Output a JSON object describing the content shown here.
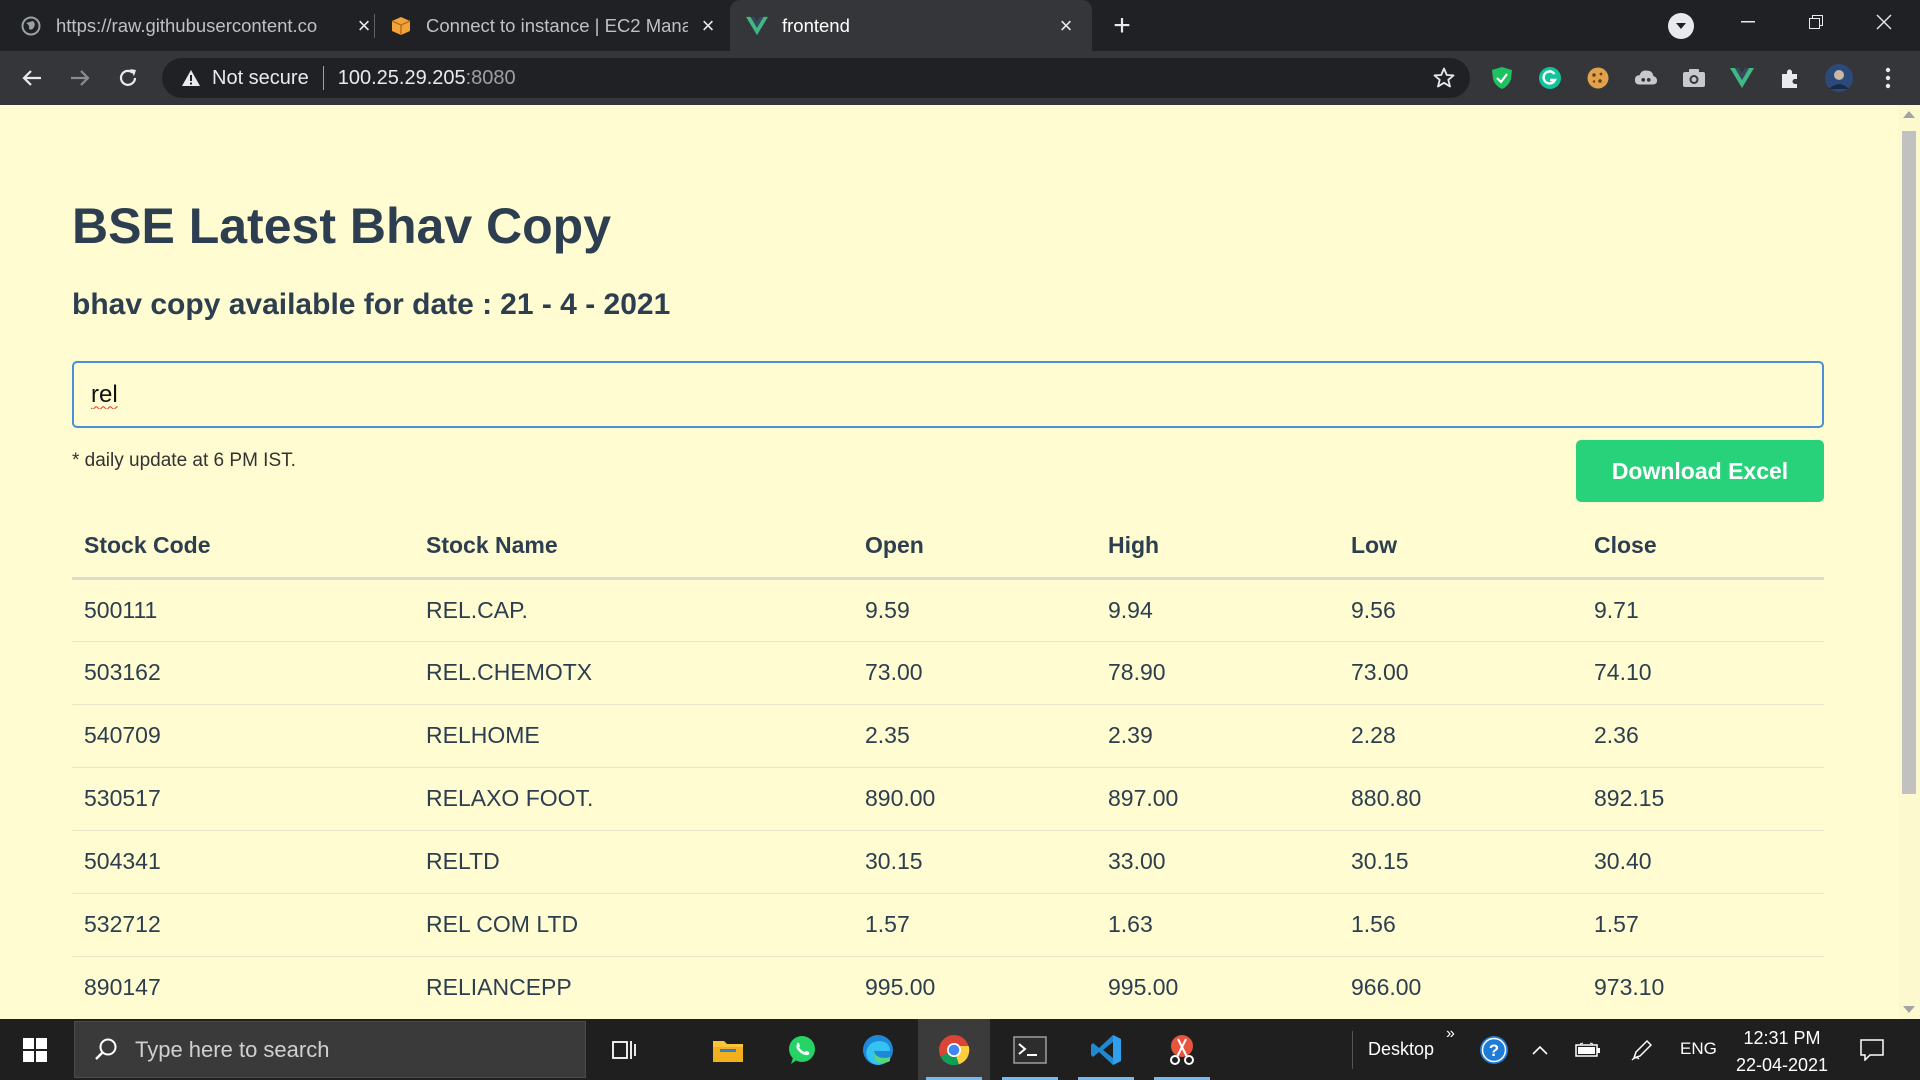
{
  "browser": {
    "tabs": [
      {
        "title": "https://raw.githubusercontent.co",
        "state": "inactive",
        "icon": "globe-icon"
      },
      {
        "title": "Connect to instance | EC2 Manag",
        "state": "inactive",
        "icon": "aws-box-icon"
      },
      {
        "title": "frontend",
        "state": "active",
        "icon": "vue-logo-icon"
      }
    ],
    "address": {
      "security_label": "Not secure",
      "host": "100.25.29.205",
      "port": ":8080"
    }
  },
  "page": {
    "title": "BSE Latest Bhav Copy",
    "date_label": "bhav copy available for date :",
    "date_value": "21 - 4 - 2021",
    "search_value": "rel",
    "update_note": "* daily update at 6 PM IST.",
    "download_label": "Download Excel",
    "table": {
      "headers": [
        "Stock Code",
        "Stock Name",
        "Open",
        "High",
        "Low",
        "Close"
      ],
      "rows": [
        [
          "500111",
          "REL.CAP.",
          "9.59",
          "9.94",
          "9.56",
          "9.71"
        ],
        [
          "503162",
          "REL.CHEMOTX",
          "73.00",
          "78.90",
          "73.00",
          "74.10"
        ],
        [
          "540709",
          "RELHOME",
          "2.35",
          "2.39",
          "2.28",
          "2.36"
        ],
        [
          "530517",
          "RELAXO FOOT.",
          "890.00",
          "897.00",
          "880.80",
          "892.15"
        ],
        [
          "504341",
          "RELTD",
          "30.15",
          "33.00",
          "30.15",
          "30.40"
        ],
        [
          "532712",
          "REL COM LTD",
          "1.57",
          "1.63",
          "1.56",
          "1.57"
        ],
        [
          "890147",
          "RELIANCEPP",
          "995.00",
          "995.00",
          "966.00",
          "973.10"
        ]
      ]
    }
  },
  "taskbar": {
    "search_placeholder": "Type here to search",
    "desktop_label": "Desktop",
    "language": "ENG",
    "time": "12:31 PM",
    "date": "22-04-2021"
  },
  "colors": {
    "page_background": "#fefcd0",
    "heading": "#2c3e50",
    "download_button": "#28d27a",
    "search_border": "#4a8fd8"
  }
}
